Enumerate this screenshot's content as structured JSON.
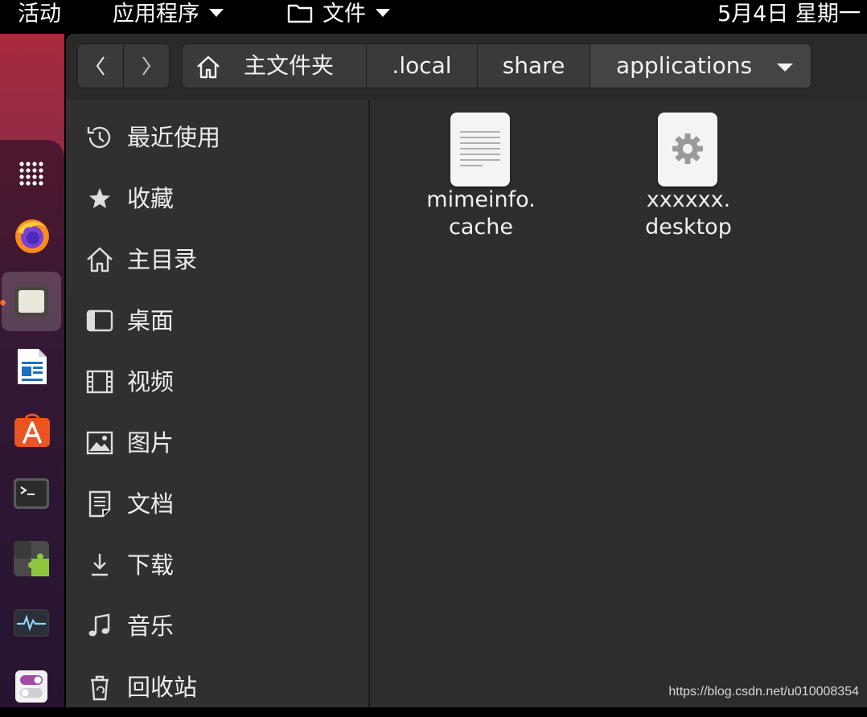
{
  "topbar": {
    "activities": "活动",
    "applications": "应用程序",
    "files_menu": "文件",
    "clock": "5月4日 星期一"
  },
  "dock": {
    "apps": [
      {
        "name": "show-applications-icon"
      },
      {
        "name": "firefox-icon"
      },
      {
        "name": "files-icon",
        "active": true
      },
      {
        "name": "libreoffice-writer-icon"
      },
      {
        "name": "software-store-icon"
      },
      {
        "name": "terminal-icon"
      },
      {
        "name": "extension-icon"
      },
      {
        "name": "system-monitor-icon"
      },
      {
        "name": "settings-toggle-icon"
      }
    ]
  },
  "header": {
    "breadcrumbs": [
      "主文件夹",
      ".local",
      "share",
      "applications"
    ]
  },
  "sidebar": {
    "items": [
      {
        "label": "最近使用",
        "icon": "recent-icon"
      },
      {
        "label": "收藏",
        "icon": "star-icon"
      },
      {
        "label": "主目录",
        "icon": "home-icon"
      },
      {
        "label": "桌面",
        "icon": "desktop-icon"
      },
      {
        "label": "视频",
        "icon": "video-icon"
      },
      {
        "label": "图片",
        "icon": "picture-icon"
      },
      {
        "label": "文档",
        "icon": "document-icon"
      },
      {
        "label": "下载",
        "icon": "download-icon"
      },
      {
        "label": "音乐",
        "icon": "music-icon"
      },
      {
        "label": "回收站",
        "icon": "trash-icon"
      }
    ]
  },
  "files": [
    {
      "line1": "mimeinfo.",
      "line2": "cache",
      "icon": "text-file-icon"
    },
    {
      "line1": "xxxxxx.",
      "line2": "desktop",
      "icon": "desktop-file-icon"
    }
  ],
  "watermark": "https://blog.csdn.net/u010008354",
  "colors": {
    "accent": "#e95420",
    "window_bg": "#2d2d2d",
    "sidebar_bg": "#303030"
  }
}
